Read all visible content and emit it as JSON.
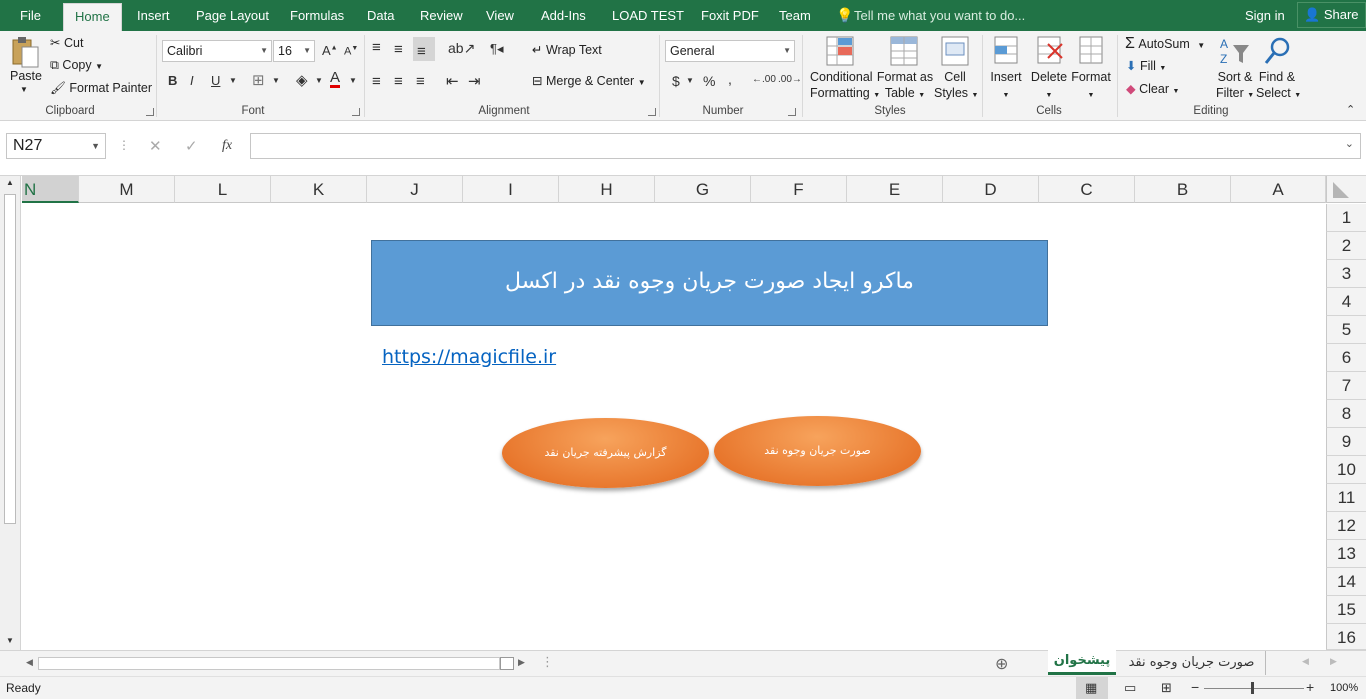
{
  "tabs": {
    "file": "File",
    "home": "Home",
    "insert": "Insert",
    "page_layout": "Page Layout",
    "formulas": "Formulas",
    "data": "Data",
    "review": "Review",
    "view": "View",
    "addins": "Add-Ins",
    "load_test": "LOAD TEST",
    "foxit": "Foxit PDF",
    "team": "Team",
    "tell_me": "Tell me what you want to do...",
    "sign_in": "Sign in",
    "share": "Share"
  },
  "clipboard": {
    "paste": "Paste",
    "cut": "Cut",
    "copy": "Copy",
    "format_painter": "Format Painter",
    "label": "Clipboard"
  },
  "font": {
    "name": "Calibri",
    "size": "16",
    "bold": "B",
    "italic": "I",
    "underline": "U",
    "label": "Font"
  },
  "alignment": {
    "wrap_text": "Wrap Text",
    "merge_center": "Merge & Center",
    "label": "Alignment"
  },
  "number": {
    "format": "General",
    "label": "Number"
  },
  "styles": {
    "conditional": "Conditional",
    "formatting": "Formatting",
    "format_as": "Format as",
    "table": "Table",
    "cell": "Cell",
    "styles_word": "Styles",
    "label": "Styles"
  },
  "cells": {
    "insert": "Insert",
    "delete": "Delete",
    "format": "Format",
    "label": "Cells"
  },
  "editing": {
    "autosum": "AutoSum",
    "fill": "Fill",
    "clear": "Clear",
    "sort": "Sort &",
    "filter": "Filter",
    "find": "Find &",
    "select": "Select",
    "label": "Editing"
  },
  "formula_bar": {
    "name_box": "N27",
    "fx": "fx",
    "value": ""
  },
  "columns": [
    "N",
    "M",
    "L",
    "K",
    "J",
    "I",
    "H",
    "G",
    "F",
    "E",
    "D",
    "C",
    "B",
    "A"
  ],
  "rows": [
    "1",
    "2",
    "3",
    "4",
    "5",
    "6",
    "7",
    "8",
    "9",
    "10",
    "11",
    "12",
    "13",
    "14",
    "15",
    "16"
  ],
  "sheet": {
    "title": "ماکرو ایجاد صورت جریان وجوه نقد در اکسل",
    "link": "https://magicfile.ir",
    "button_left": "گزارش پیشرفته جریان نقد",
    "button_right": "صورت جریان وجوه نقد"
  },
  "sheet_tabs": {
    "active": "پیشخوان",
    "other": "صورت جریان وجوه نقد"
  },
  "status": {
    "ready": "Ready",
    "zoom": "100%"
  },
  "colors": {
    "excel_green": "#217346",
    "title_fill": "#5b9bd5",
    "button_orange": "#ed7d31"
  }
}
